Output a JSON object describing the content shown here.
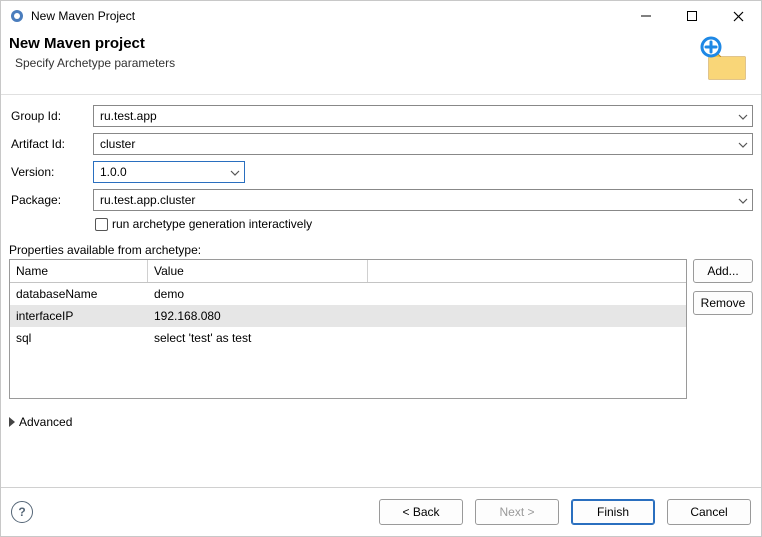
{
  "window": {
    "title": "New Maven Project"
  },
  "header": {
    "title": "New Maven project",
    "subtitle": "Specify Archetype parameters"
  },
  "form": {
    "group_id_label": "Group Id:",
    "group_id_value": "ru.test.app",
    "artifact_id_label": "Artifact Id:",
    "artifact_id_value": "cluster",
    "version_label": "Version:",
    "version_value": "1.0.0",
    "package_label": "Package:",
    "package_value": "ru.test.app.cluster",
    "run_interactive_label": "run archetype generation interactively",
    "run_interactive_checked": false
  },
  "props": {
    "section_label": "Properties available from archetype:",
    "columns": {
      "name": "Name",
      "value": "Value"
    },
    "rows": [
      {
        "name": "databaseName",
        "value": "demo",
        "selected": false
      },
      {
        "name": "interfaceIP",
        "value": "192.168.080",
        "selected": true
      },
      {
        "name": "sql",
        "value": "select 'test' as test",
        "selected": false
      }
    ],
    "add_label": "Add...",
    "remove_label": "Remove"
  },
  "advanced": {
    "label": "Advanced"
  },
  "footer": {
    "back": "< Back",
    "next": "Next >",
    "finish": "Finish",
    "cancel": "Cancel"
  }
}
